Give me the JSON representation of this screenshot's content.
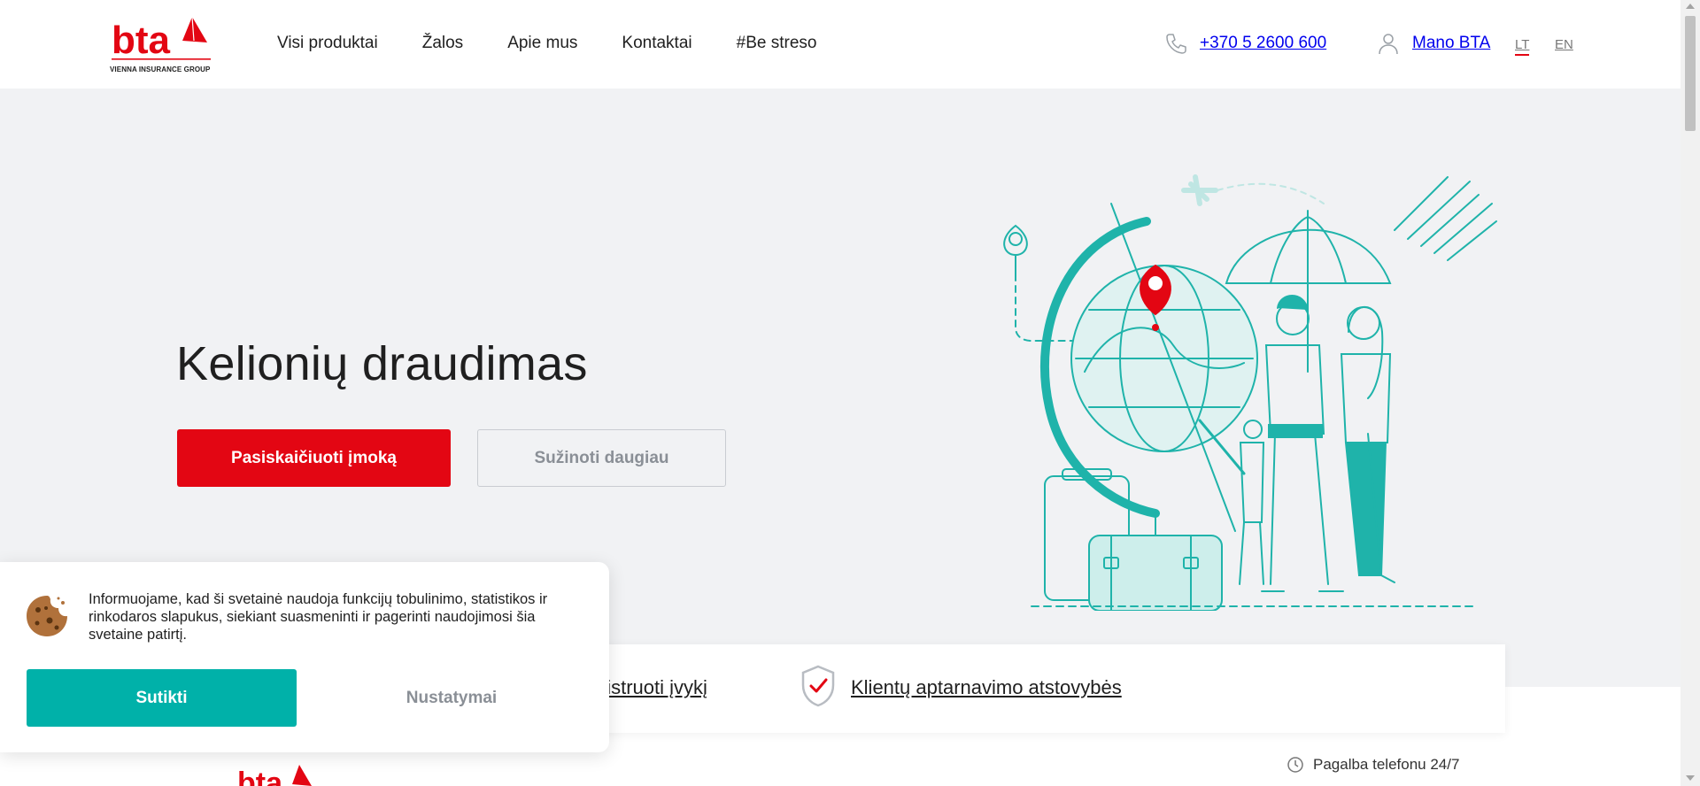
{
  "colors": {
    "brand_red": "#e30613",
    "teal": "#00b1a9",
    "hero_bg": "#f1f2f4"
  },
  "header": {
    "logo_text": "bta",
    "logo_subtitle": "VIENNA INSURANCE GROUP",
    "nav": [
      "Visi produktai",
      "Žalos",
      "Apie mus",
      "Kontaktai",
      "#Be streso"
    ],
    "phone_icon": "phone-icon",
    "phone": "+370 5 2600 600",
    "account_icon": "user-icon",
    "account": "Mano BTA",
    "lang_lt": "LT",
    "lang_en": "EN",
    "active_lang": "LT"
  },
  "hero": {
    "title": "Kelionių draudimas",
    "primary_button": "Pasiskaičiuoti įmoką",
    "secondary_button": "Sužinoti daugiau",
    "illustration": "travel-insurance-illustration"
  },
  "quickbar": {
    "item_register": "gistruoti įvykį",
    "shield_icon": "shield-check-icon",
    "item_offices": "Klientų aptarnavimo atstovybės"
  },
  "footer": {
    "help_icon": "clock-icon",
    "help_text": "Pagalba telefonu 24/7"
  },
  "cookie": {
    "icon": "cookie-icon",
    "text": "Informuojame, kad ši svetainė naudoja funkcijų tobulinimo, statistikos ir rinkodaros slapukus, siekiant suasmeninti ir pagerinti naudojimosi šia svetaine patirtį.",
    "accept": "Sutikti",
    "settings": "Nustatymai"
  }
}
